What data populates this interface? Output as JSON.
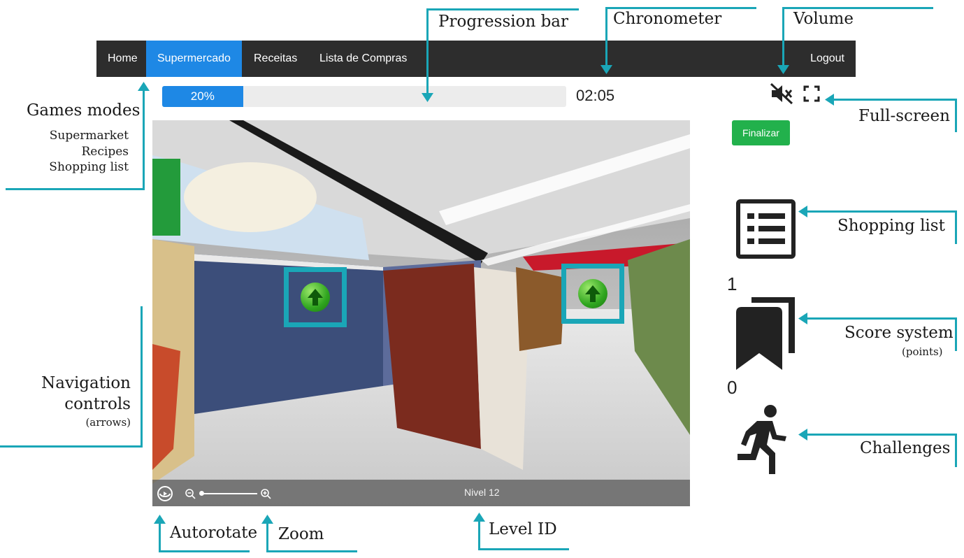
{
  "nav": {
    "items": [
      {
        "label": "Home",
        "active": false
      },
      {
        "label": "Supermercado",
        "active": true
      },
      {
        "label": "Receitas",
        "active": false
      },
      {
        "label": "Lista de Compras",
        "active": false
      }
    ],
    "logout_label": "Logout"
  },
  "progress": {
    "label": "20%",
    "value": 0.2
  },
  "timer": "02:05",
  "finalize_label": "Finalizar",
  "viewer": {
    "level_label": "Nivel 12"
  },
  "scores": {
    "shopping_count": "1",
    "points": "0"
  },
  "annotations": {
    "progression_bar": "Progression bar",
    "chronometer": "Chronometer",
    "volume": "Volume",
    "full_screen": "Full-screen",
    "games_modes": "Games modes",
    "supermarket": "Supermarket",
    "recipes": "Recipes",
    "shopping_list_mode": "Shopping list",
    "shopping_list": "Shopping list",
    "score_system": "Score system",
    "points": "(points)",
    "navigation_controls_1": "Navigation",
    "navigation_controls_2": "controls",
    "arrows": "(arrows)",
    "challenges": "Challenges",
    "autorotate": "Autorotate",
    "zoom": "Zoom",
    "level_id": "Level ID"
  },
  "colors": {
    "accent": "#1e88e5",
    "navbar": "#2d2d2d",
    "finalize": "#22b14c",
    "callout": "#1aa6b7"
  },
  "icons": [
    "mute-icon",
    "fullscreen-icon",
    "shopping-list-icon",
    "score-bookmark-icon",
    "running-person-icon",
    "autorotate-icon",
    "zoom-out-icon",
    "zoom-in-icon",
    "arrow-up-hotspot-icon"
  ]
}
